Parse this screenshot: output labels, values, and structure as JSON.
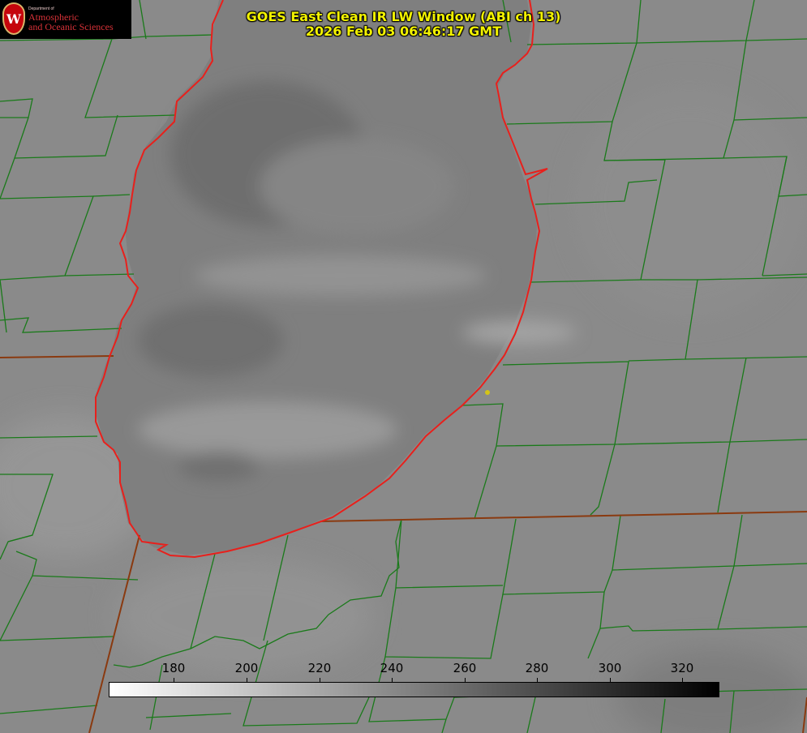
{
  "header": {
    "title_line1": "GOES East Clean IR LW Window (ABI ch 13)",
    "title_line2": "2026 Feb 03 06:46:17 GMT"
  },
  "logo": {
    "dept": "Department of",
    "line1": "Atmospheric",
    "line2": "and Oceanic Sciences",
    "seal_letter": "W"
  },
  "colorbar": {
    "ticks": [
      "180",
      "200",
      "220",
      "240",
      "260",
      "280",
      "300",
      "320"
    ],
    "gradient_from": "#ffffff",
    "gradient_to": "#000000"
  },
  "colors": {
    "county_lines": "#1a7a1a",
    "shoreline": "#e8201c",
    "state_lines": "#8a3a10",
    "title_text": "#f2f200",
    "marker": "#d4c417"
  }
}
